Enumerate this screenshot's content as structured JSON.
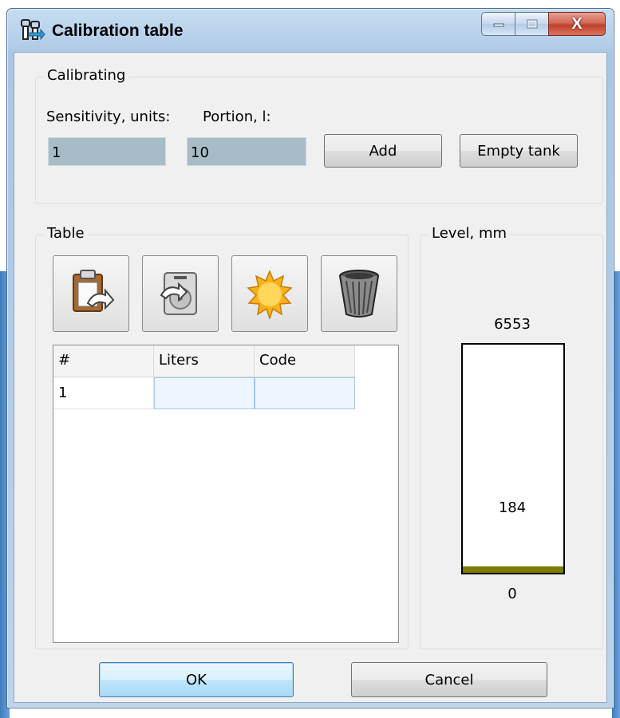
{
  "window": {
    "title": "Calibration table",
    "caption_buttons": {
      "minimize_icon": "minimize-icon",
      "maximize_icon": "maximize-icon",
      "close_label": "X"
    }
  },
  "calibrating": {
    "group_label": "Calibrating",
    "sensitivity_label": "Sensitivity, units:",
    "sensitivity_value": "1",
    "portion_label": "Portion, l:",
    "portion_value": "10",
    "add_label": "Add",
    "empty_tank_label": "Empty tank"
  },
  "table": {
    "group_label": "Table",
    "toolbar": [
      "paste-icon",
      "load-icon",
      "new-icon",
      "delete-icon"
    ],
    "columns": [
      "#",
      "Liters",
      "Code"
    ],
    "rows": [
      {
        "num": "1",
        "liters": "",
        "code": ""
      }
    ]
  },
  "level": {
    "group_label": "Level, mm",
    "max": "6553",
    "current": "184",
    "min": "0",
    "fill_fraction": 0.028,
    "fill_color": "#7d7c00"
  },
  "footer": {
    "ok_label": "OK",
    "cancel_label": "Cancel"
  }
}
